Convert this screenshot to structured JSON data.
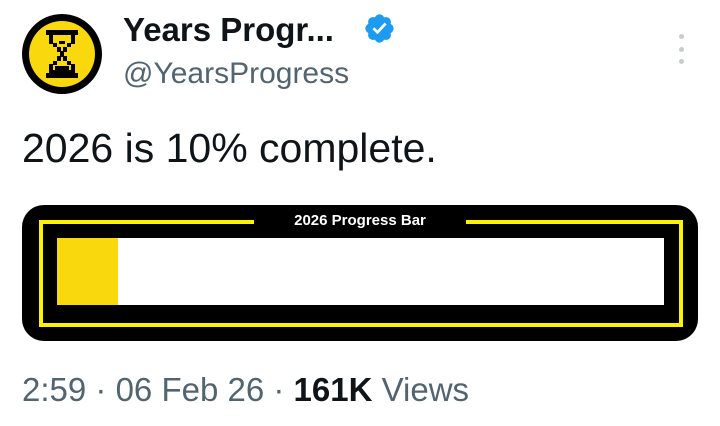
{
  "account": {
    "display_name": "Years Progr...",
    "handle": "@YearsProgress",
    "avatar_icon": "hourglass-icon",
    "verified_icon": "verified-badge-icon",
    "verified_color": "#1d9bf0"
  },
  "menu": {
    "icon": "more-options-icon"
  },
  "tweet": {
    "text": "2026 is 10% complete."
  },
  "media": {
    "caption": "2026 Progress Bar",
    "progress_fraction": 0.1,
    "fill_color": "#f9d80d",
    "frame_color": "#fff200",
    "background_color": "#000000"
  },
  "meta": {
    "time": "2:59",
    "separator": "·",
    "date": "06 Feb 26",
    "views_count": "161K",
    "views_label": "Views"
  }
}
